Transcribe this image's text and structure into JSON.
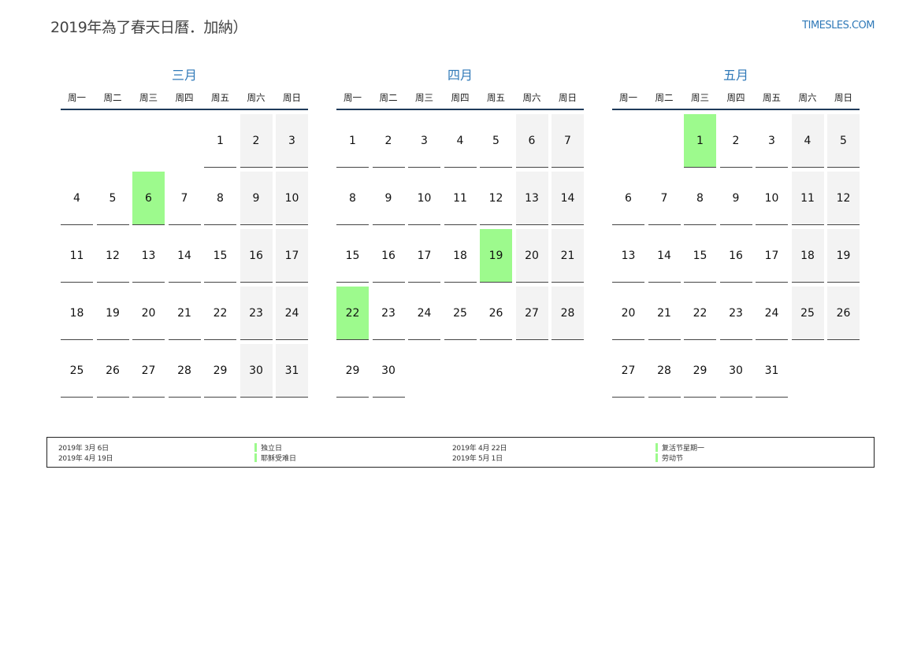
{
  "header": {
    "title": "2019年為了春天日曆．加納）",
    "site": "TIMESLES.COM"
  },
  "colors": {
    "accent": "#2f79b8",
    "holiday": "#9dfa8d",
    "weekend": "#f3f3f3",
    "divider": "#1f3a5a"
  },
  "weekdays": [
    "周一",
    "周二",
    "周三",
    "周四",
    "周五",
    "周六",
    "周日"
  ],
  "months": [
    {
      "name": "三月",
      "offset": 4,
      "days": 31,
      "holidays": [
        6
      ]
    },
    {
      "name": "四月",
      "offset": 0,
      "days": 30,
      "holidays": [
        19,
        22
      ]
    },
    {
      "name": "五月",
      "offset": 2,
      "days": 31,
      "holidays": [
        1
      ]
    }
  ],
  "legend": [
    {
      "date": "2019年 3月 6日",
      "name": "独立日"
    },
    {
      "date": "2019年 4月 19日",
      "name": "耶稣受难日"
    },
    {
      "date": "2019年 4月 22日",
      "name": "复活节星期一"
    },
    {
      "date": "2019年 5月 1日",
      "name": "劳动节"
    }
  ]
}
